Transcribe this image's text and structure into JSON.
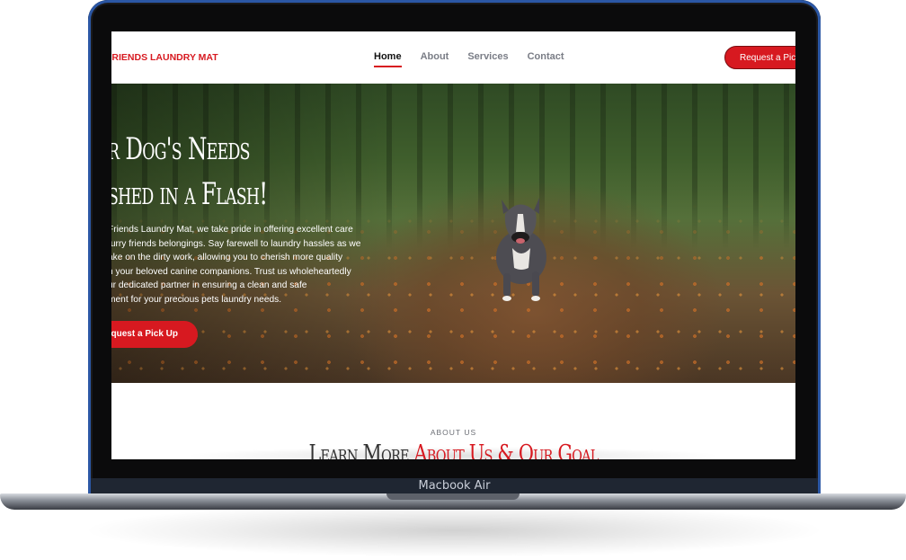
{
  "device": {
    "label": "Macbook Air"
  },
  "nav": {
    "brand": "FRIENDS LAUNDRY MAT",
    "items": [
      {
        "label": "Home",
        "active": true
      },
      {
        "label": "About"
      },
      {
        "label": "Services"
      },
      {
        "label": "Contact"
      }
    ],
    "cta_label": "Request a Pick"
  },
  "hero": {
    "title_lines": [
      "r Dog's Needs",
      "shed in a Flash!"
    ],
    "body_lines": [
      "Friends Laundry Mat, we take pride in offering excellent care",
      "furry friends belongings. Say farewell to laundry hassles as we",
      "ake on the dirty work, allowing you to cherish more quality",
      "h your beloved canine companions. Trust us wholeheartedly",
      "ur dedicated partner in ensuring a clean and safe",
      "ment for your precious pets laundry needs."
    ],
    "cta_label": "quest a Pick Up"
  },
  "about": {
    "eyebrow": "ABOUT US",
    "heading_prefix": "Learn More",
    "heading_highlight": "About Us & Our Goal"
  },
  "colors": {
    "accent": "#d71920",
    "bezel": "#2b57a5"
  }
}
